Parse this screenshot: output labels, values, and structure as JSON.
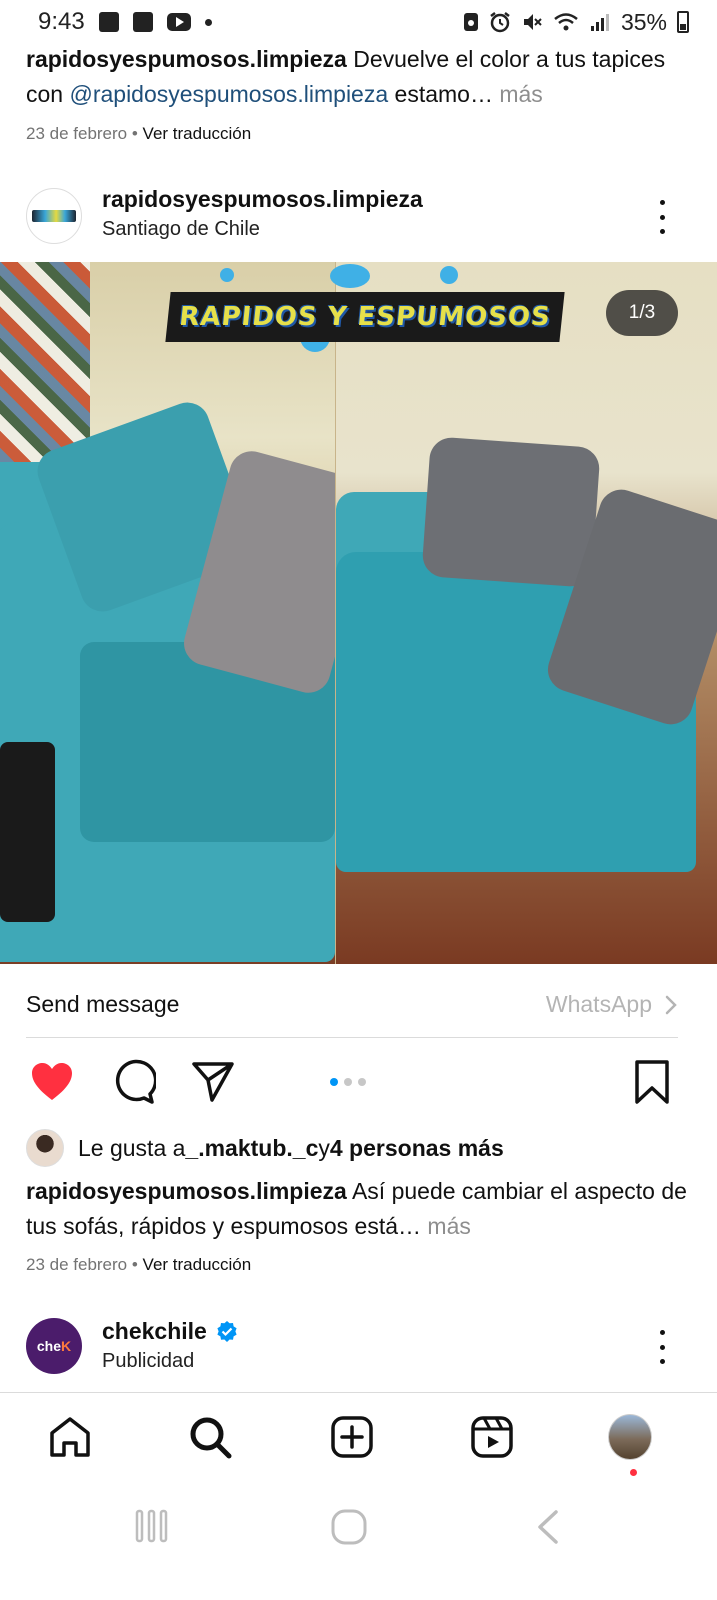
{
  "status_bar": {
    "time": "9:43",
    "battery": "35%",
    "icons": [
      "gallery-icon",
      "app-icon",
      "youtube-icon",
      "dot-icon",
      "ring-icon",
      "alarm-icon",
      "mute-icon",
      "wifi-icon",
      "signal-icon",
      "battery-icon"
    ]
  },
  "post1": {
    "caption": {
      "username": "rapidosyespumosos.limpieza",
      "text_before": " Devuelve el color a tus tapices con ",
      "mention": "@rapidosyespumosos.limpieza",
      "text_after": " estamo…",
      "more": " más"
    },
    "date": "23 de febrero",
    "separator": " • ",
    "translate": "Ver traducción"
  },
  "post2": {
    "username": "rapidosyespumosos.limpieza",
    "location": "Santiago de Chile",
    "watermark": "RAPIDOS Y ESPUMOSOS",
    "counter": "1/3",
    "send_message": "Send message",
    "whatsapp": "WhatsApp",
    "carousel": {
      "count": 3,
      "active": 0
    },
    "likes": {
      "prefix": "Le gusta a ",
      "user": "_.maktub._c",
      "middle": " y ",
      "others": "4 personas más"
    },
    "caption": {
      "username": "rapidosyespumosos.limpieza",
      "text": " Así puede cambiar el aspecto de tus sofás, rápidos y espumosos está…",
      "more": " más"
    },
    "date": "23 de febrero",
    "separator": " • ",
    "translate": "Ver traducción"
  },
  "ad": {
    "avatar_text": "che",
    "avatar_accent": "K",
    "username": "chekchile",
    "subtitle": "Publicidad",
    "verified": true
  },
  "colors": {
    "like_red": "#ff3040",
    "link_blue": "#1f4f7a",
    "active_dot": "#0095f6",
    "muted": "#737373"
  }
}
